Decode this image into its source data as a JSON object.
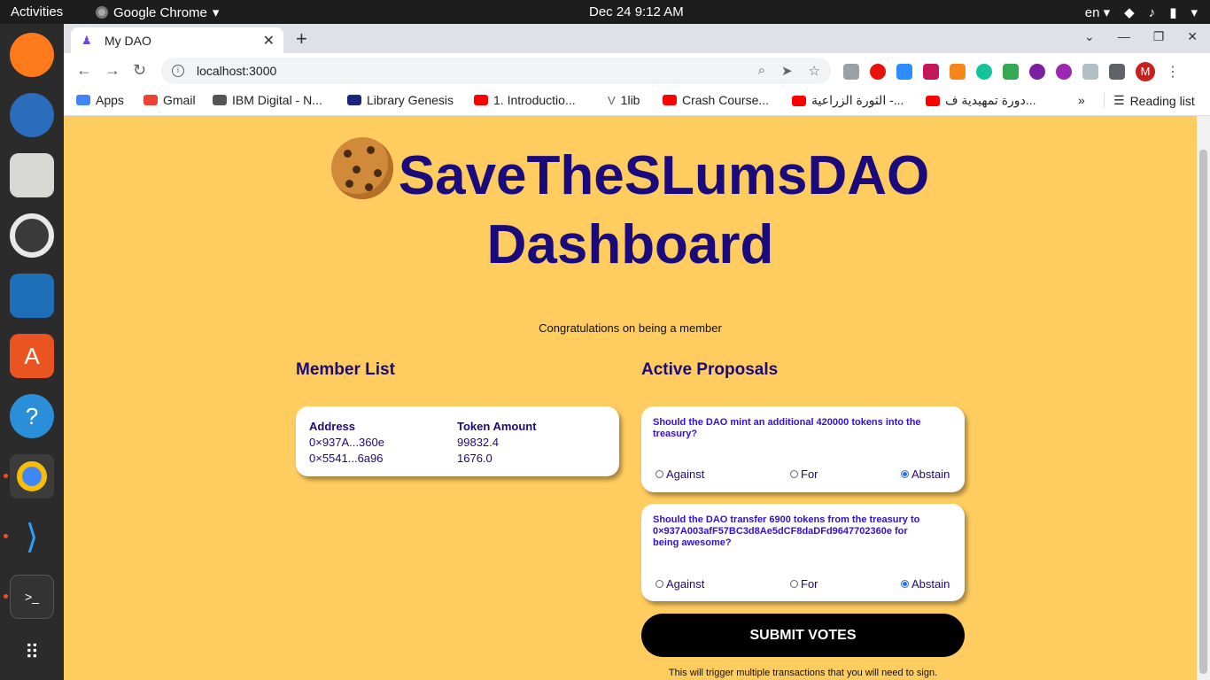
{
  "system": {
    "activities": "Activities",
    "app_name": "Google Chrome",
    "clock": "Dec 24  9:12 AM",
    "lang": "en"
  },
  "browser": {
    "tab_title": "My DAO",
    "url": "localhost:3000",
    "bookmarks": [
      {
        "label": "Apps",
        "color": "#4285f4"
      },
      {
        "label": "Gmail",
        "color": "#ea4335"
      },
      {
        "label": "IBM Digital - N...",
        "color": "#555555"
      },
      {
        "label": "Library Genesis",
        "color": "#1a237e"
      },
      {
        "label": "1. Introductio...",
        "color": "#ff0000"
      },
      {
        "label": "1lib",
        "color": "#666666"
      },
      {
        "label": "Crash Course...",
        "color": "#ff0000"
      },
      {
        "label": "الثورة الزراعية -...",
        "color": "#ff0000"
      },
      {
        "label": "دورة تمهيدية ف...",
        "color": "#ff0000"
      }
    ],
    "more_bookmarks": "»",
    "reading_list": "Reading list",
    "profile_initial": "M"
  },
  "page": {
    "title_line1": "SaveTheSLumsDAO",
    "title_line2": "Dashboard",
    "congrats": "Congratulations on being a member",
    "member_list_heading": "Member List",
    "proposals_heading": "Active Proposals",
    "members": {
      "col_address": "Address",
      "col_amount": "Token Amount",
      "rows": [
        {
          "address": "0×937A...360e",
          "amount": "99832.4"
        },
        {
          "address": "0×5541...6a96",
          "amount": "1676.0"
        }
      ]
    },
    "proposals": [
      {
        "question": "Should the DAO mint an additional 420000 tokens into the treasury?",
        "options": {
          "against": "Against",
          "for": "For",
          "abstain": "Abstain"
        },
        "selected": "abstain"
      },
      {
        "question": "Should the DAO transfer 6900 tokens from the treasury to 0×937A003afF57BC3d8Ae5dCF8daDFd9647702360e for being awesome?",
        "options": {
          "against": "Against",
          "for": "For",
          "abstain": "Abstain"
        },
        "selected": "abstain"
      }
    ],
    "submit_label": "SUBMIT VOTES",
    "submit_note": "This will trigger multiple transactions that you will need to sign."
  }
}
